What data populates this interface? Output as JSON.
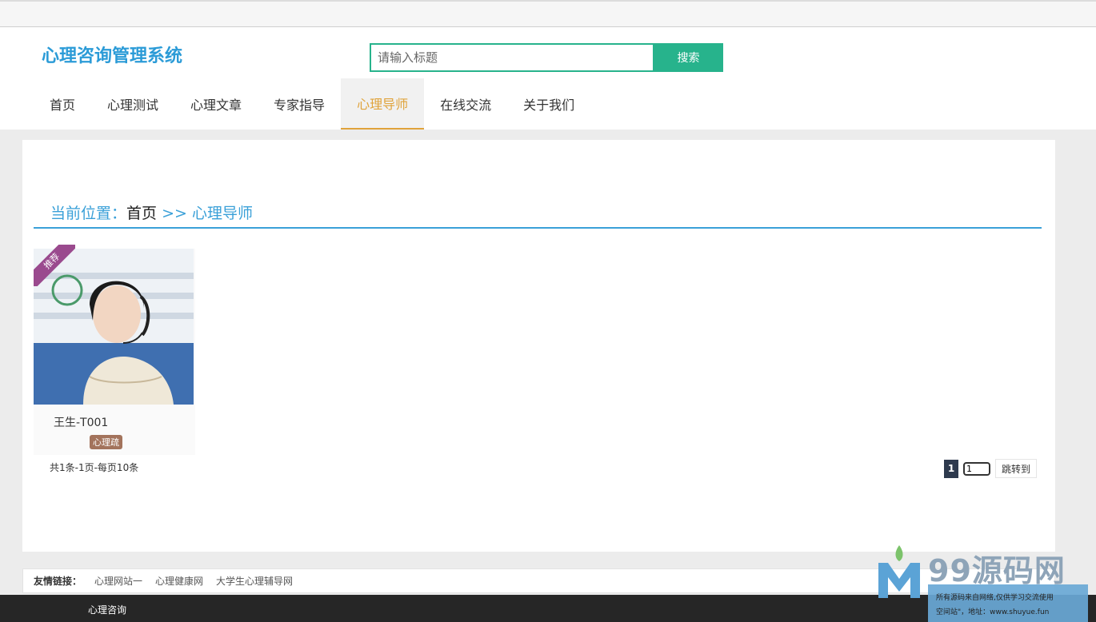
{
  "header": {
    "logo": "心理咨询管理系统",
    "search_placeholder": "请输入标题",
    "search_button": "搜索"
  },
  "nav": {
    "items": [
      "首页",
      "心理测试",
      "心理文章",
      "专家指导",
      "心理导师",
      "在线交流",
      "关于我们"
    ],
    "active": "心理导师"
  },
  "breadcrumb": {
    "label": "当前位置：",
    "home": "首页",
    "separator": ">>",
    "current": "心理导师"
  },
  "card": {
    "ribbon": "推荐",
    "name": "王生-T001",
    "badge": "心理疏"
  },
  "pagination": {
    "info": "共1条-1页-每页10条",
    "current_page": "1",
    "input_value": "1",
    "jump_label": "跳转到"
  },
  "friend_links": {
    "label": "友情链接：",
    "items": [
      "心理网站一",
      "心理健康网",
      "大学生心理辅导网"
    ]
  },
  "footer": {
    "text": "心理咨询"
  },
  "watermark": {
    "brand": "99源码网",
    "line1": "所有源码来自网络,仅供学习交流使用",
    "line2": "空间站\"，地址：www.shuyue.fun"
  },
  "colors": {
    "accent_green": "#27b38c",
    "brand_blue": "#2b9bd7",
    "active_nav": "#e0a33a",
    "ribbon": "#9a4a8e",
    "badge": "#a3735c",
    "footer": "#262626"
  }
}
